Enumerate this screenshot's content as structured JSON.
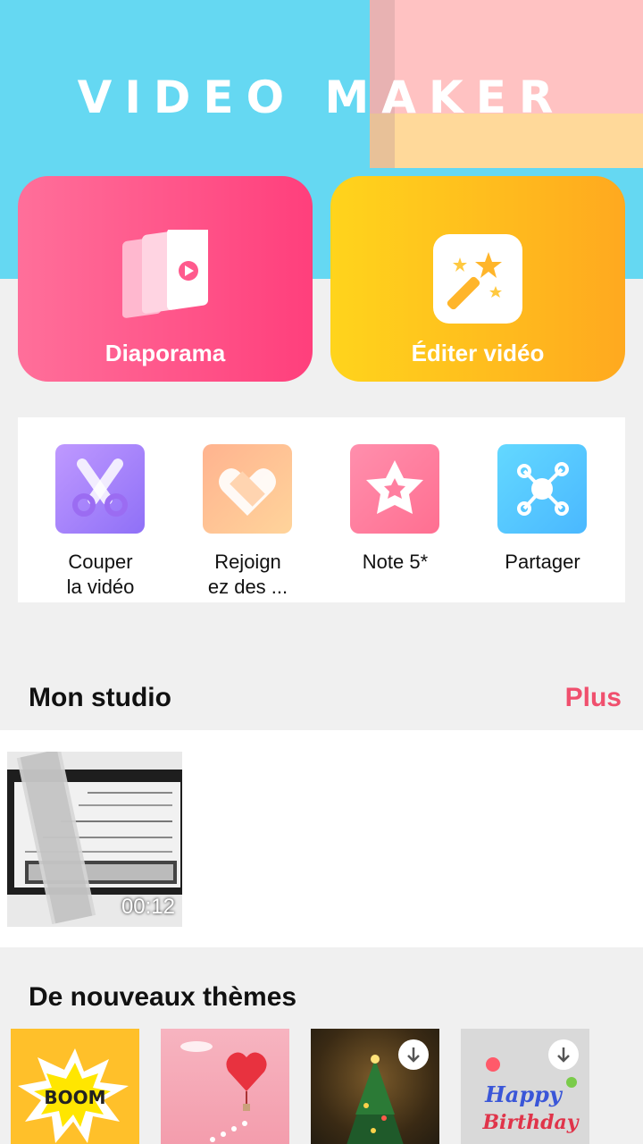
{
  "header": {
    "app_title": "VIDEO MAKER"
  },
  "main_actions": [
    {
      "label": "Diaporama",
      "icon": "slideshow-icon"
    },
    {
      "label": "Éditer vidéo",
      "icon": "magic-wand-icon"
    }
  ],
  "tools": [
    {
      "label": "Couper\nla vidéo",
      "icon": "scissors-icon"
    },
    {
      "label": "Rejoign\nez des ...",
      "icon": "film-heart-icon"
    },
    {
      "label": "Note 5*",
      "icon": "star-icon"
    },
    {
      "label": "Partager",
      "icon": "share-icon"
    }
  ],
  "studio": {
    "title": "Mon studio",
    "more_label": "Plus",
    "videos": [
      {
        "duration": "00:12"
      }
    ]
  },
  "themes": {
    "title": "De nouveaux thèmes",
    "items": [
      {
        "name": "boom-theme",
        "art_text": "BOOM",
        "downloadable": false
      },
      {
        "name": "heart-balloon-theme",
        "downloadable": false
      },
      {
        "name": "christmas-tree-theme",
        "downloadable": true
      },
      {
        "name": "happy-birthday-theme",
        "art_text": "Happy Birthday",
        "downloadable": true
      }
    ]
  },
  "colors": {
    "banner_blue": "#65d8f2",
    "slideshow_pink": "#ff4f86",
    "edit_yellow": "#ffb81f",
    "accent_red": "#f0506e"
  }
}
